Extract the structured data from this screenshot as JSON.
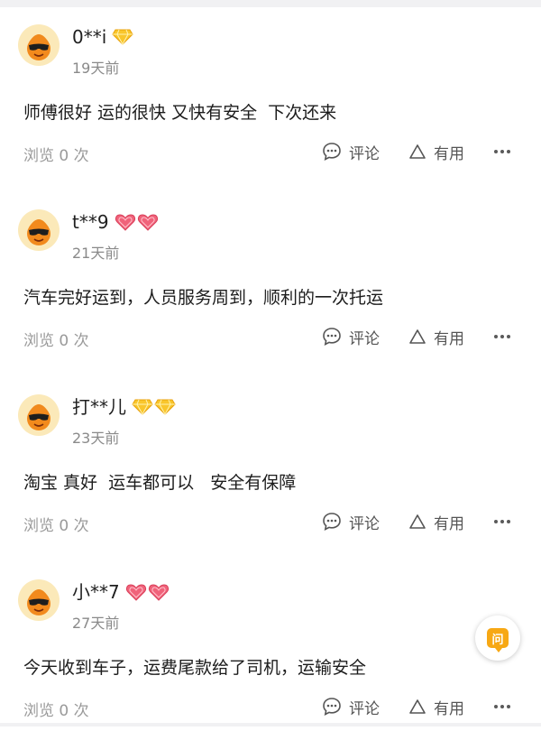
{
  "reviews": [
    {
      "username": "0**i",
      "badges": [
        "diamond-icon"
      ],
      "date": "19天前",
      "content": "师傅很好 运的很快 又快有安全  下次还来",
      "views": "浏览 0 次",
      "comment_label": "评论",
      "useful_label": "有用"
    },
    {
      "username": "t**9",
      "badges": [
        "heart-icon",
        "heart-icon"
      ],
      "date": "21天前",
      "content": "汽车完好运到，人员服务周到，顺利的一次托运",
      "views": "浏览 0 次",
      "comment_label": "评论",
      "useful_label": "有用"
    },
    {
      "username": "打**儿",
      "badges": [
        "diamond-icon",
        "diamond-icon"
      ],
      "date": "23天前",
      "content": "淘宝 真好  运车都可以   安全有保障",
      "views": "浏览 0 次",
      "comment_label": "评论",
      "useful_label": "有用"
    },
    {
      "username": "小**7",
      "badges": [
        "heart-icon",
        "heart-icon"
      ],
      "date": "27天前",
      "content": "今天收到车子，运费尾款给了司机，运输安全",
      "views": "浏览 0 次",
      "comment_label": "评论",
      "useful_label": "有用"
    }
  ],
  "ask_button": {
    "label": "问"
  },
  "colors": {
    "accent": "#f7a814",
    "diamond": "#f9c62c",
    "heart": "#f0627a",
    "muted": "#9a9a9a"
  }
}
